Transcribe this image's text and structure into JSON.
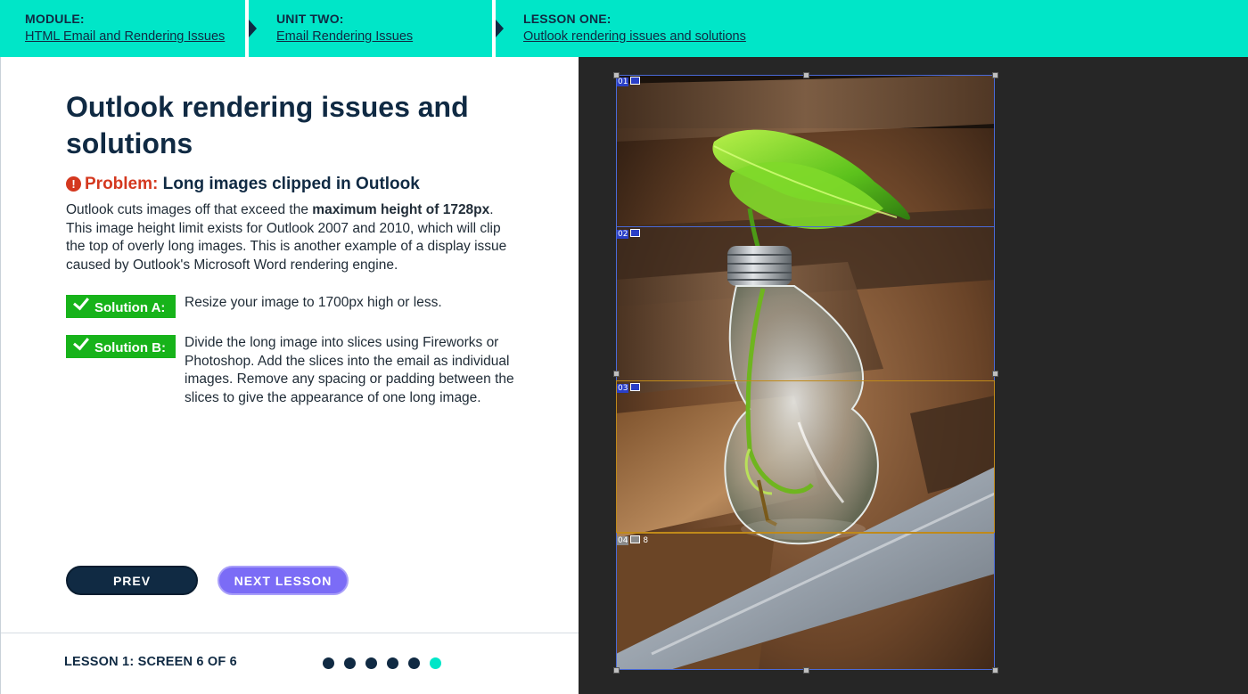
{
  "breadcrumb": {
    "module": {
      "label": "MODULE:",
      "link": "HTML Email and Rendering Issues"
    },
    "unit": {
      "label": "UNIT TWO:",
      "link": "Email Rendering Issues"
    },
    "lesson": {
      "label": "LESSON ONE:",
      "link": "Outlook rendering issues and solutions"
    }
  },
  "content": {
    "title": "Outlook rendering issues and solutions",
    "problem_label": "Problem:",
    "problem_text": "Long images clipped in Outlook",
    "desc_part1": "Outlook cuts images off that exceed the ",
    "desc_bold": "maximum height of 1728px",
    "desc_part2": ". This image height limit exists for Outlook 2007 and 2010, which will clip the top of overly long images. This is another example of a display issue caused by Outlook's Microsoft Word rendering engine.",
    "solutions": [
      {
        "label": "Solution A:",
        "text": "Resize your image to 1700px high or less."
      },
      {
        "label": "Solution B:",
        "text": "Divide the long image into slices using Fireworks or Photoshop. Add the slices into the email as individual images. Remove any spacing or padding between the slices to give the appearance of one long image."
      }
    ]
  },
  "nav": {
    "prev_label": "PREV",
    "next_label": "NEXT LESSON"
  },
  "footer": {
    "screen_count": "LESSON 1: SCREEN 6 OF 6",
    "total_screens": 6,
    "current_screen": 6
  },
  "editor": {
    "slices": [
      {
        "num": "01"
      },
      {
        "num": "02"
      },
      {
        "num": "03"
      },
      {
        "num": "04",
        "extra": "8"
      }
    ],
    "colors": {
      "background": "#262626",
      "slice_selected": "#4a6ad8",
      "slice_active": "#c08a1a"
    }
  },
  "colors": {
    "accent": "#00e6c8",
    "navy": "#102a43",
    "problem_red": "#d4381f",
    "solution_green": "#17b31a",
    "next_purple": "#7b6cf6"
  }
}
